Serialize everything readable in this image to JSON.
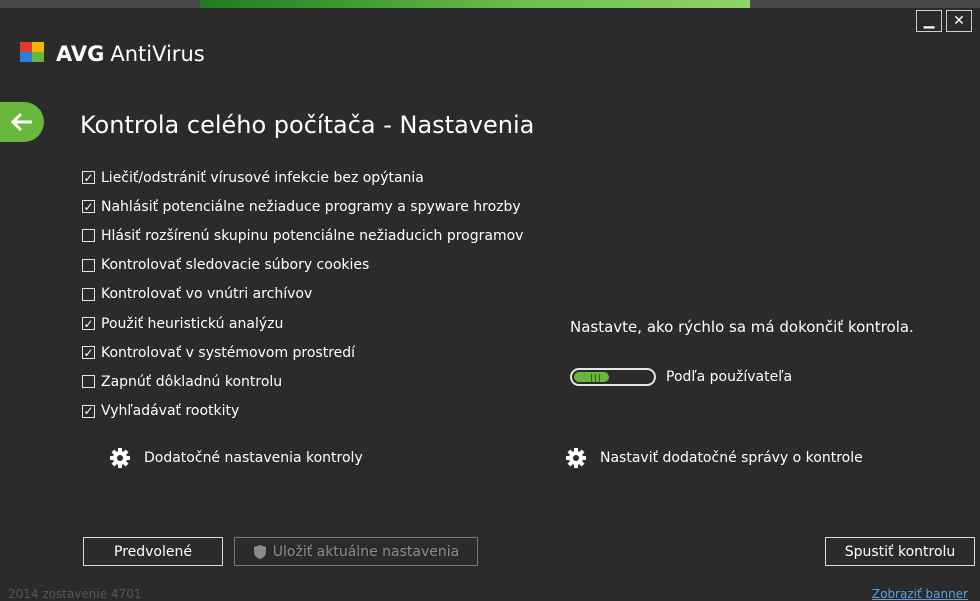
{
  "window": {
    "minimize_icon": "minimize-icon",
    "close_icon": "close-icon"
  },
  "brand": {
    "company": "AVG",
    "product": "AntiVirus"
  },
  "page": {
    "title": "Kontrola celého počítača - Nastavenia"
  },
  "options": [
    {
      "label": "Liečiť/odstrániť vírusové infekcie bez opýtania",
      "checked": true
    },
    {
      "label": "Nahlásiť potenciálne nežiaduce programy a spyware hrozby",
      "checked": true
    },
    {
      "label": "Hlásiť rozšírenú skupinu potenciálne nežiaducich programov",
      "checked": false
    },
    {
      "label": "Kontrolovať sledovacie súbory cookies",
      "checked": false
    },
    {
      "label": "Kontrolovať vo vnútri archívov",
      "checked": false
    },
    {
      "label": "Použiť heuristickú analýzu",
      "checked": true
    },
    {
      "label": "Kontrolovať v systémovom prostredí",
      "checked": true
    },
    {
      "label": "Zapnúť dôkladnú kontrolu",
      "checked": false
    },
    {
      "label": "Vyhľadávať rootkity",
      "checked": true
    }
  ],
  "speed": {
    "title": "Nastavte, ako rýchlo sa má dokončiť kontrola.",
    "label": "Podľa používateľa",
    "fill_fraction": 0.45
  },
  "links": {
    "additional_settings": "Dodatočné nastavenia kontroly",
    "reports": "Nastaviť dodatočné správy o kontrole"
  },
  "buttons": {
    "defaults": "Predvolené",
    "save": "Uložiť aktuálne nastavenia",
    "start": "Spustiť kontrolu"
  },
  "footer": {
    "build": "2014  zostavenie 4701",
    "banner": "Zobraziť banner"
  },
  "colors": {
    "accent": "#69b83b",
    "background": "#2b2b2b"
  }
}
